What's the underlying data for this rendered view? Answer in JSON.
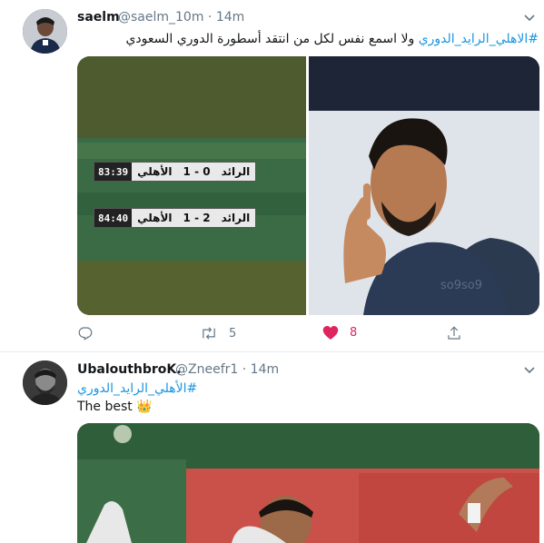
{
  "tweets": [
    {
      "user_name": "saelm",
      "handle": "@saelm_10m",
      "time": "14m",
      "text_hashtag": "#الاهلي_الرايد_الدوري",
      "text_body": "ولا اسمع نفس لكل من انتقد أسطورة الدوري السعودي",
      "scoreboard": [
        {
          "clock": "83:39",
          "home": "الأهلي",
          "score": "1 - 0",
          "away": "الرائد"
        },
        {
          "clock": "84:40",
          "home": "الأهلي",
          "score": "1 - 2",
          "away": "الرائد"
        }
      ],
      "watermark": "so9so9",
      "retweets": "5",
      "likes": "8"
    },
    {
      "user_name": "UbalouthbroK.",
      "handle": "@Zneefr1",
      "time": "14m",
      "text_hashtag": "#الأهلي_الرايد_الدوري",
      "text_body": "The best 👑"
    }
  ],
  "colors": {
    "link": "#1b95e0",
    "secondary": "#657786",
    "like": "#e0245e",
    "divider": "#e6ecf0"
  },
  "icons": [
    "reply-icon",
    "retweet-icon",
    "heart-icon",
    "share-icon",
    "chevron-down-icon"
  ]
}
